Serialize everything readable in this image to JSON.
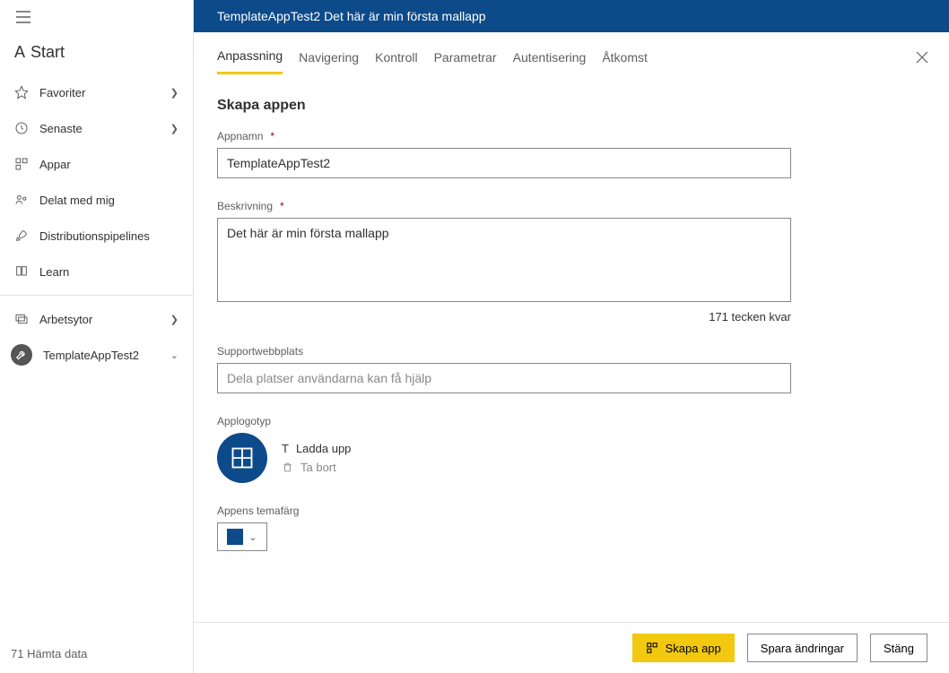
{
  "sidebar": {
    "home": "Start",
    "items": [
      {
        "label": "Favoriter"
      },
      {
        "label": "Senaste"
      },
      {
        "label": "Appar"
      },
      {
        "label": "Delat med mig"
      },
      {
        "label": "Distributionspipelines"
      },
      {
        "label": "Learn"
      }
    ],
    "workspaces_label": "Arbetsytor",
    "current_workspace": "TemplateAppTest2",
    "footer": "Hämta data",
    "footer_prefix": "71"
  },
  "header": {
    "title": "TemplateAppTest2 Det här är min första mallapp"
  },
  "tabs": [
    {
      "label": "Anpassning"
    },
    {
      "label": "Navigering"
    },
    {
      "label": "Kontroll"
    },
    {
      "label": "Parametrar"
    },
    {
      "label": "Autentisering"
    },
    {
      "label": "Åtkomst"
    }
  ],
  "form": {
    "section_title": "Skapa appen",
    "appname_label": "Appnamn",
    "appname_value": "TemplateAppTest2",
    "description_label": "Beskrivning",
    "description_value": "Det här är min första mallapp",
    "char_counter": "171 tecken kvar",
    "support_label": "Supportwebbplats",
    "support_placeholder": "Dela platser användarna kan få hjälp",
    "logo_label": "Applogotyp",
    "upload_label": "Ladda upp",
    "delete_label": "Ta bort",
    "theme_label": "Appens temafärg",
    "theme_color": "#0d4a8a"
  },
  "footer_bar": {
    "create": "Skapa app",
    "save": "Spara ändringar",
    "close": "Stäng"
  }
}
